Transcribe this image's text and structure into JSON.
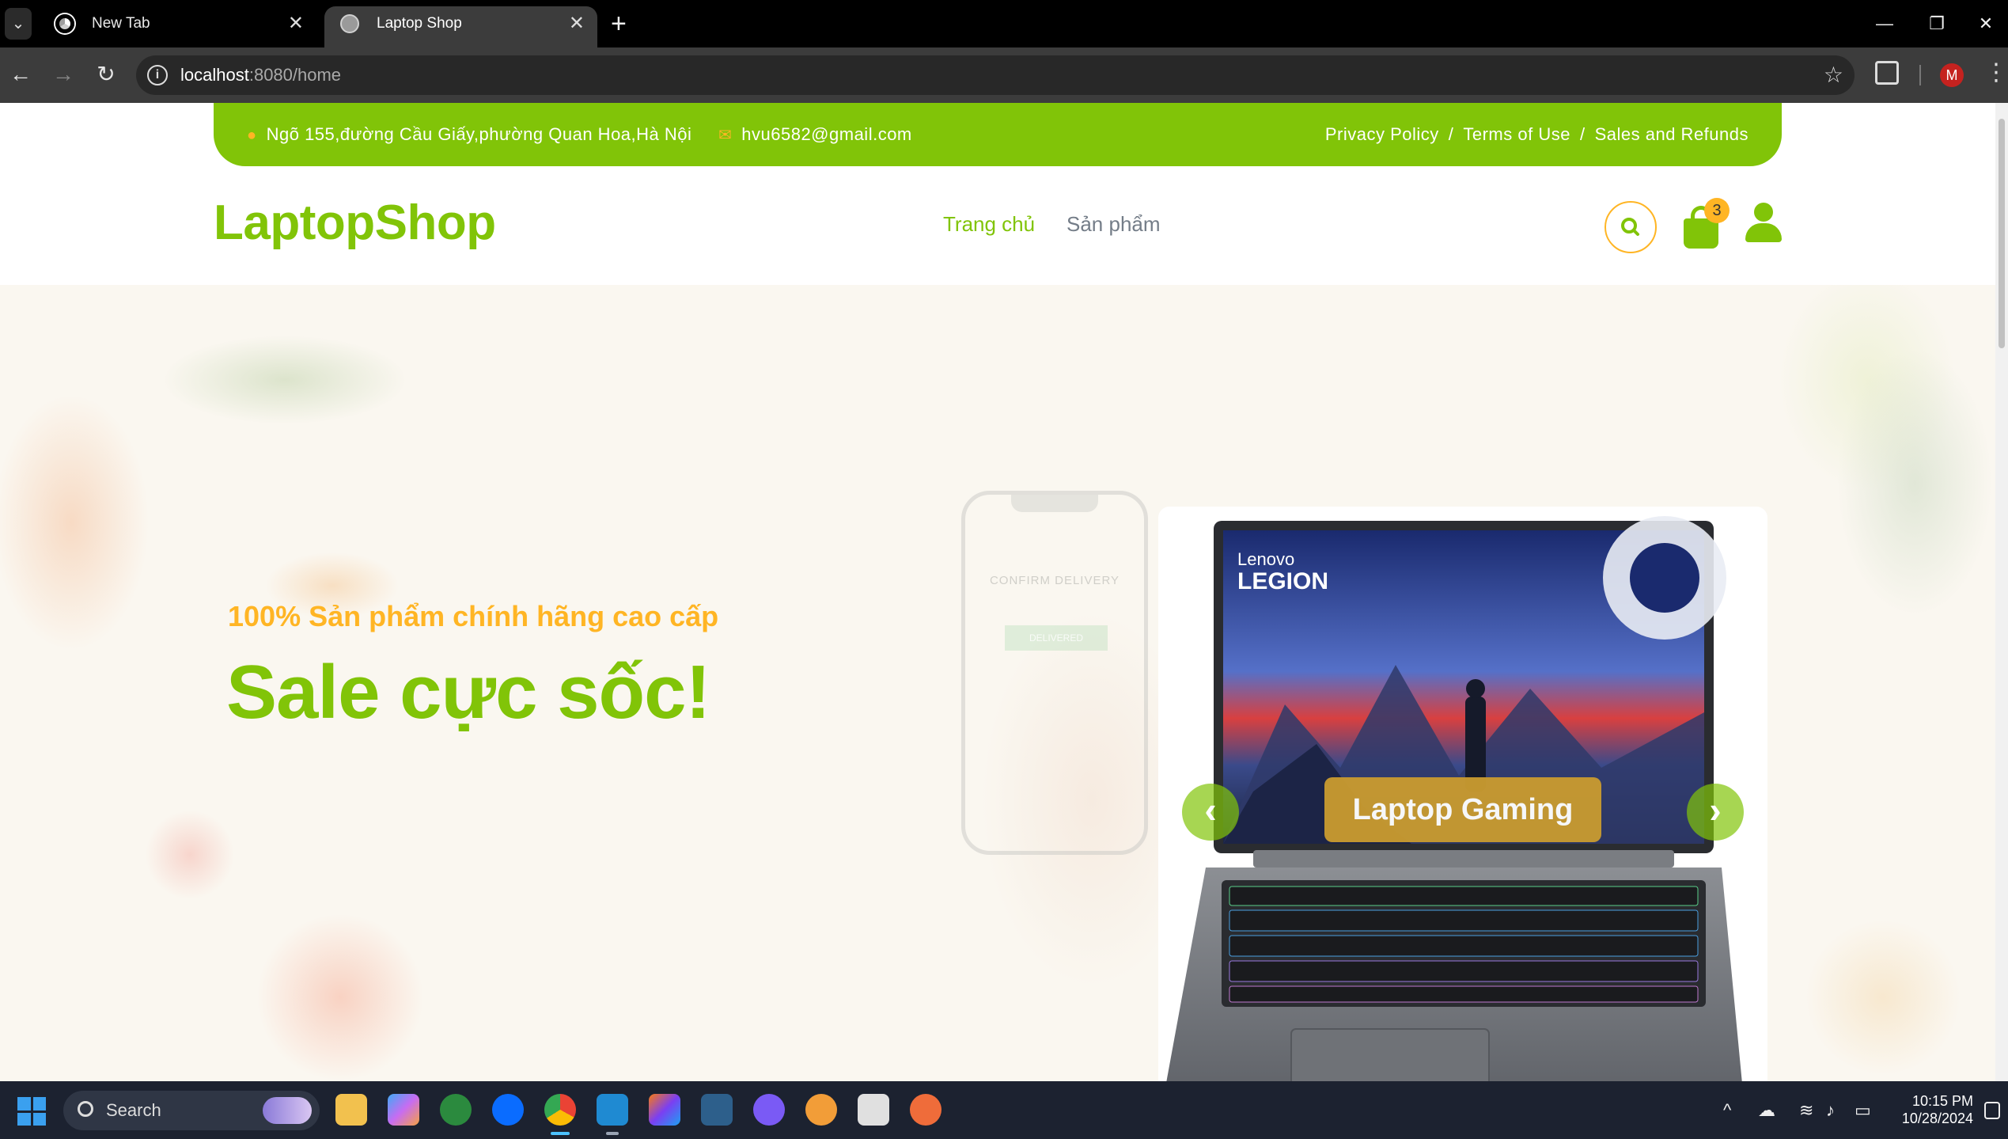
{
  "browser": {
    "tabs": [
      {
        "title": "New Tab",
        "active": false
      },
      {
        "title": "Laptop Shop",
        "active": true
      }
    ],
    "url_host": "localhost",
    "url_rest": ":8080/home",
    "profile_initial": "M"
  },
  "topbar": {
    "address": "Ngõ 155,đường Cầu Giấy,phường Quan Hoa,Hà Nội",
    "email": "hvu6582@gmail.com",
    "links": [
      "Privacy Policy",
      "Terms of Use",
      "Sales and Refunds"
    ],
    "separator": "/"
  },
  "header": {
    "logo": "LaptopShop",
    "menu": [
      {
        "label": "Trang chủ",
        "active": true
      },
      {
        "label": "Sản phẩm",
        "active": false
      }
    ],
    "cart_count": "3"
  },
  "hero": {
    "subtitle": "100% Sản phẩm chính hãng cao cấp",
    "title": "Sale cực sốc!",
    "carousel_caption": "Laptop Gaming",
    "carousel_image_brand": "Lenovo",
    "carousel_image_model": "LEGION",
    "background_phone_text": "CONFIRM DELIVERY",
    "background_phone_button": "DELIVERED"
  },
  "taskbar": {
    "search_label": "Search",
    "time": "10:15 PM",
    "date": "10/28/2024"
  },
  "colors": {
    "brand_green": "#81c408",
    "accent_orange": "#ffb524",
    "menu_gray": "#747d88",
    "caption_gold": "#c89a30"
  }
}
